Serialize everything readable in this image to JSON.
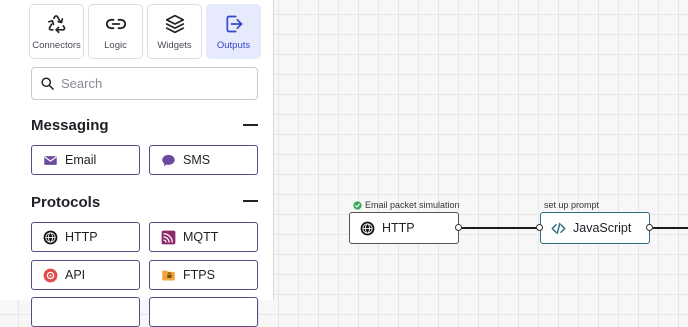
{
  "tabs": [
    {
      "label": "Connectors",
      "icon": "recycle-icon",
      "active": false
    },
    {
      "label": "Logic",
      "icon": "logic-link-icon",
      "active": false
    },
    {
      "label": "Widgets",
      "icon": "layers-icon",
      "active": false
    },
    {
      "label": "Outputs",
      "icon": "output-icon",
      "active": true
    }
  ],
  "search": {
    "placeholder": "Search",
    "value": ""
  },
  "sections": {
    "messaging": {
      "title": "Messaging",
      "items": [
        {
          "label": "Email",
          "icon": "mail-icon"
        },
        {
          "label": "SMS",
          "icon": "chat-icon"
        }
      ]
    },
    "protocols": {
      "title": "Protocols",
      "items": [
        {
          "label": "HTTP",
          "icon": "globe-icon"
        },
        {
          "label": "MQTT",
          "icon": "mqtt-icon"
        },
        {
          "label": "API",
          "icon": "api-icon"
        },
        {
          "label": "FTPS",
          "icon": "ftps-icon"
        }
      ]
    }
  },
  "canvas": {
    "nodes": [
      {
        "label": "HTTP",
        "caption": "Email packet simulation",
        "caption_status": "success",
        "icon": "globe-icon"
      },
      {
        "label": "JavaScript",
        "caption": "set up prompt",
        "icon": "code-icon"
      }
    ]
  },
  "colors": {
    "accent": "#3347c9",
    "active_tab_bg": "#e7e9fc",
    "node_border_default": "#555555",
    "node_border_selected": "#2f6f83",
    "success": "#3aa757",
    "mqtt": "#8e2a6b",
    "api": "#e34b4b",
    "ftps": "#f2a33a",
    "messaging_icon": "#6b4a9e"
  }
}
